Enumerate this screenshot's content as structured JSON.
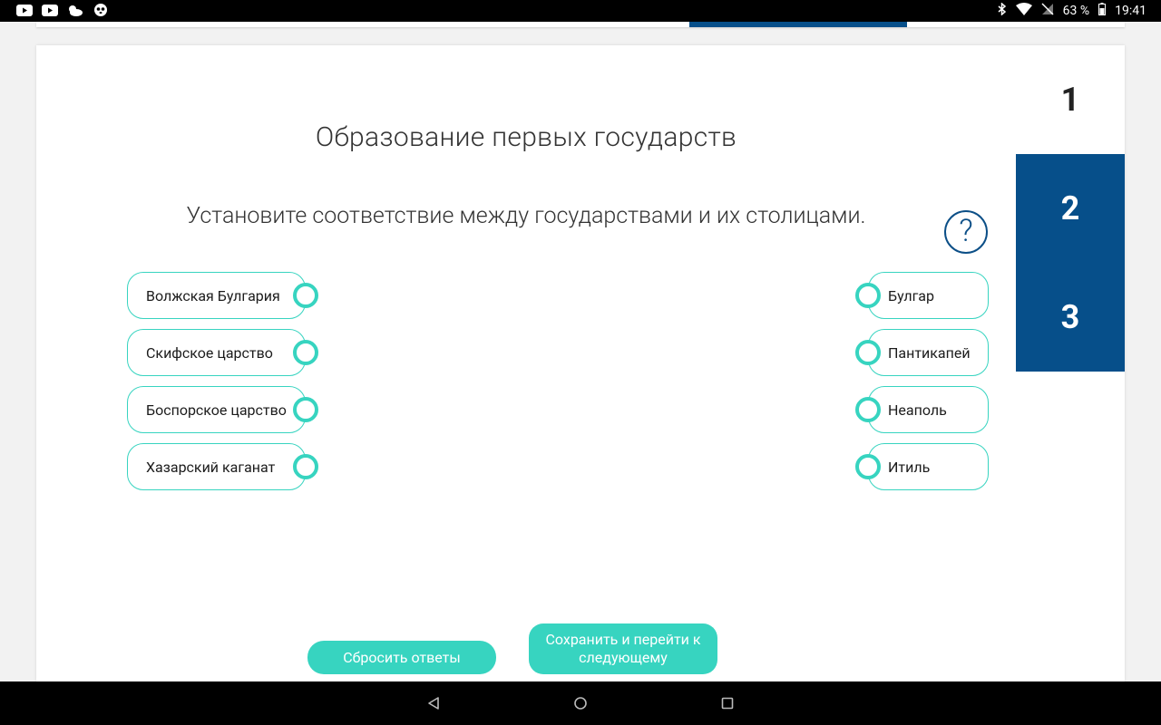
{
  "status_bar": {
    "battery": "63 %",
    "time": "19:41",
    "left_icons": [
      "youtube-icon",
      "youtube-icon",
      "weather-icon",
      "panda-icon"
    ],
    "right_icons": [
      "bluetooth-icon",
      "wifi-icon",
      "no-sim-icon",
      "battery-icon"
    ]
  },
  "task": {
    "title": "Образование первых государств",
    "instruction": "Установите соответствие между государствами и их столицами.",
    "help_symbol": "?"
  },
  "question_nav": [
    {
      "label": "1",
      "active": false
    },
    {
      "label": "2",
      "active": true
    },
    {
      "label": "3",
      "active": true
    }
  ],
  "left_items": [
    {
      "label": "Волжская Булгария"
    },
    {
      "label": "Скифское царство"
    },
    {
      "label": "Боспорское царство"
    },
    {
      "label": "Хазарский каганат"
    }
  ],
  "right_items": [
    {
      "label": "Булгар"
    },
    {
      "label": "Пантикапей"
    },
    {
      "label": "Неаполь"
    },
    {
      "label": "Итиль"
    }
  ],
  "buttons": {
    "reset_label": "Сбросить ответы",
    "save_label": "Сохранить и перейти к следующему"
  },
  "colors": {
    "accent_teal": "#37d4c0",
    "nav_blue": "#064f8a"
  }
}
